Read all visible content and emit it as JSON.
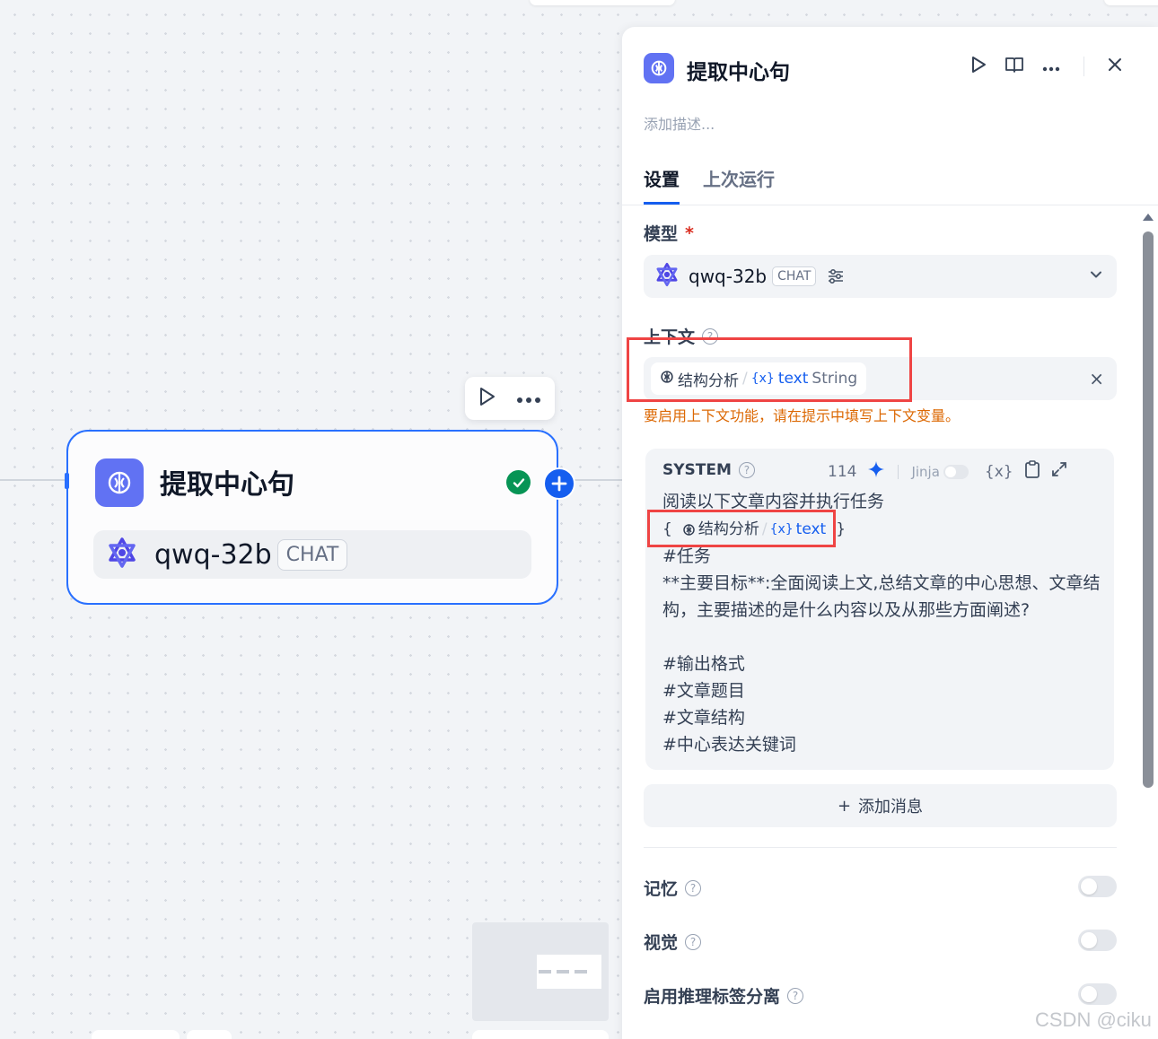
{
  "canvas": {
    "node": {
      "title": "提取中心句",
      "model_name": "qwq-32b",
      "model_tag": "CHAT",
      "status": "success"
    },
    "toolbar": {
      "run_icon": "play-icon",
      "more_icon": "more-icon"
    }
  },
  "panel": {
    "title": "提取中心句",
    "description_placeholder": "添加描述...",
    "tabs": [
      {
        "label": "设置",
        "active": true
      },
      {
        "label": "上次运行",
        "active": false
      }
    ],
    "model": {
      "label": "模型",
      "required_mark": "*",
      "name": "qwq-32b",
      "tag": "CHAT"
    },
    "context": {
      "label": "上下文",
      "help": "?",
      "variable": {
        "node": "结构分析",
        "separator": "/",
        "var_icon": "{x}",
        "name": "text",
        "type": "String"
      },
      "warning": "要启用上下文功能，请在提示中填写上下文变量。",
      "close": "×"
    },
    "system": {
      "role": "SYSTEM",
      "help": "?",
      "token_count": "114",
      "jinja_label": "Jinja",
      "var_button": "{x}",
      "lines": {
        "l1": "阅读以下文章内容并执行任务",
        "open_brace": "{",
        "inline_node": "结构分析",
        "inline_sep": "/",
        "inline_var_icon": "{x}",
        "inline_var": "text",
        "close_brace": "}",
        "l3": "#任务",
        "l4": "**主要目标**:全面阅读上文,总结文章的中心思想、文章结构，主要描述的是什么内容以及从那些方面阐述?",
        "l5": "#输出格式",
        "l6": "#文章题目",
        "l7": "#文章结构",
        "l8": "#中心表达关键词"
      }
    },
    "add_message": {
      "plus": "+",
      "label": "添加消息"
    },
    "settings": [
      {
        "label": "记忆",
        "help": "?",
        "enabled": false
      },
      {
        "label": "视觉",
        "help": "?",
        "enabled": false
      },
      {
        "label": "启用推理标签分离",
        "help": "?",
        "enabled": false
      }
    ]
  },
  "watermark": "CSDN @ciku",
  "colors": {
    "accent": "#155eef",
    "node_icon": "#6172f3",
    "warning": "#dc6803",
    "success": "#079455",
    "highlight_box": "#ef4444"
  }
}
